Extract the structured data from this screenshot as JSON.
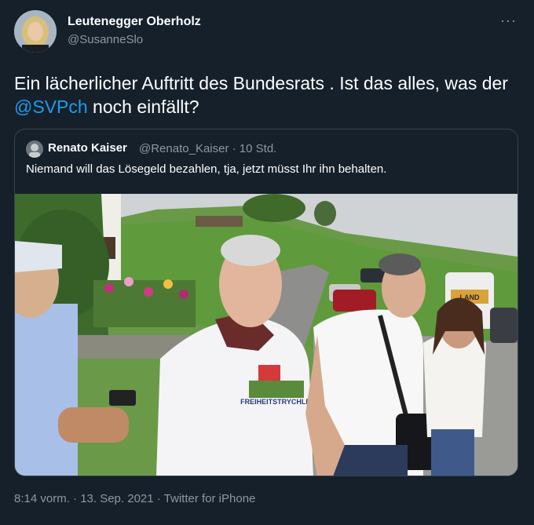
{
  "tweet": {
    "author_name": "Leutenegger Oberholz",
    "author_handle": "@SusanneSlo",
    "text_part1": "Ein lächerlicher Auftritt des Bundesrats . Ist das alles, was der ",
    "mention": "@SVPch",
    "text_part2": " noch einfällt?",
    "more_icon": "···",
    "footer": "8:14 vorm. · 13. Sep. 2021 · Twitter for iPhone"
  },
  "quote": {
    "author_name": "Renato Kaiser",
    "author_handle": "@Renato_Kaiser",
    "time": "· 10 Std.",
    "text": "Niemand will das Lösegeld bezahlen, tja, jetzt müsst Ihr ihn behalten."
  },
  "photo": {
    "shirt_print": "FREIHEITSTRYCHLER",
    "van_sign": "LAND"
  },
  "colors": {
    "background": "#15202b",
    "text": "#ffffff",
    "secondary": "#8b98a5",
    "link": "#1d9bf0",
    "border": "#38444d"
  }
}
